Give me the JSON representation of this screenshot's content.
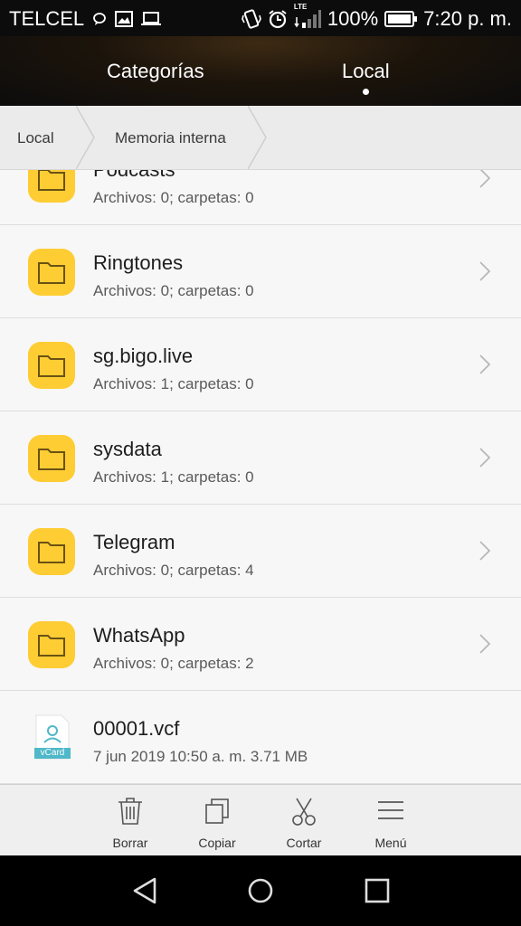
{
  "status_bar": {
    "carrier": "TELCEL",
    "lte": "LTE",
    "battery": "100%",
    "time": "7:20 p. m.",
    "left_icons": [
      "chat-bubble-icon",
      "image-icon",
      "laptop-icon"
    ],
    "right_icons": [
      "vibrate-icon",
      "alarm-icon",
      "signal-icon",
      "battery-icon"
    ]
  },
  "tabs": [
    {
      "label": "Categorías"
    },
    {
      "label": "Local",
      "selected": true
    }
  ],
  "breadcrumb": [
    "Local",
    "Memoria interna"
  ],
  "files": [
    {
      "name": "Podcasts",
      "info": "Archivos: 0; carpetas: 0",
      "type": "folder"
    },
    {
      "name": "Ringtones",
      "info": "Archivos: 0; carpetas: 0",
      "type": "folder"
    },
    {
      "name": "sg.bigo.live",
      "info": "Archivos: 1; carpetas: 0",
      "type": "folder"
    },
    {
      "name": "sysdata",
      "info": "Archivos: 1; carpetas: 0",
      "type": "folder"
    },
    {
      "name": "Telegram",
      "info": "Archivos: 0; carpetas: 4",
      "type": "folder"
    },
    {
      "name": "WhatsApp",
      "info": "Archivos: 0; carpetas: 2",
      "type": "folder"
    },
    {
      "name": "00001.vcf",
      "info": "7 jun 2019 10:50 a. m. 3.71 MB",
      "type": "vcard",
      "badge": "vCard"
    }
  ],
  "toolbar": [
    {
      "label": "Borrar",
      "icon": "trash-icon"
    },
    {
      "label": "Copiar",
      "icon": "copy-icon"
    },
    {
      "label": "Cortar",
      "icon": "scissors-icon"
    },
    {
      "label": "Menú",
      "icon": "menu-icon"
    }
  ],
  "nav_bar": [
    "back-icon",
    "home-icon",
    "recents-icon"
  ],
  "colors": {
    "folder": "#fecd34",
    "accent_dark": "#0c0c0c",
    "vcard": "#4fb8c9"
  }
}
